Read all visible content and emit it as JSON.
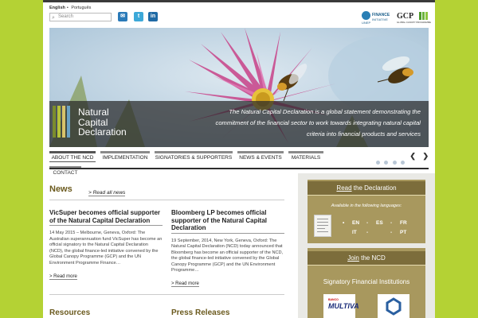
{
  "header": {
    "languages": [
      "English",
      "Português"
    ],
    "language_separator": "•",
    "search_placeholder": "Search",
    "social": [
      {
        "icon": "email-icon",
        "label": "✉",
        "color": "#2a7ab8"
      },
      {
        "icon": "twitter-icon",
        "label": "t",
        "color": "#3ca8d8"
      },
      {
        "icon": "linkedin-icon",
        "label": "in",
        "color": "#1f6aa5"
      }
    ],
    "unep_text1": "FINANCE",
    "unep_text2": "INITIATIVE",
    "unep_prefix": "UNEP",
    "gcp_text": "GCP",
    "gcp_subtext": "GLOBAL CANOPY PROGRAMME"
  },
  "hero": {
    "logo_lines": [
      "Natural",
      "Capital",
      "Declaration"
    ],
    "tagline": "The Natural Capital Declaration is a global statement demonstrating the commitment of the financial sector to work towards integrating natural capital criteria into financial products and services",
    "logo_colors": [
      "#7b8c2d",
      "#b4c23a",
      "#d8c36a",
      "#6ba2c4"
    ]
  },
  "nav": {
    "items": [
      "ABOUT THE NCD",
      "IMPLEMENTATION",
      "SIGNATORIES & SUPPORTERS",
      "NEWS & EVENTS",
      "MATERIALS"
    ],
    "contact": "CONTACT",
    "prev": "❮",
    "next": "❯"
  },
  "news": {
    "title": "News",
    "read_all": "> Read all news",
    "articles": [
      {
        "title": "VicSuper becomes official supporter of the Natural Capital Declaration",
        "body": "14 May 2015 – Melbourne, Geneva, Oxford: The Australian superannuation fund VicSuper has become an official signatory to the Natural Capital Declaration (NCD), the global finance-led initiative convened by the Global Canopy Programme (GCP) and the UN Environment Programme Finance…",
        "more": "> Read more"
      },
      {
        "title": "Bloomberg LP becomes official supporter of the Natural Capital Declaration",
        "body": "19 September, 2014, New York, Geneva, Oxford: The Natural Capital Declaration (NCD) today announced that Bloomberg has become an official supporter of the NCD, the global finance-led initiative convened by the Global Canopy Programme (GCP) and the UN Environment Programme…",
        "more": "> Read more"
      }
    ]
  },
  "sections": {
    "resources": "Resources",
    "press": "Press Releases"
  },
  "sidebar": {
    "read_title_prefix": "Read",
    "read_title_suffix": " the Declaration",
    "available": "Available in the following languages:",
    "languages": [
      "EN",
      "ES",
      "FR",
      "IT",
      "PT"
    ],
    "language_dash": "-",
    "join_title_prefix": "Join",
    "join_title_suffix": " the NCD",
    "signatory_label": "Signatory Financial Institutions",
    "bank1_small": "BANCO",
    "bank1": "MULTIVA"
  },
  "colors": {
    "page_bg": "#b4d234",
    "accent_gold": "#a8985e",
    "heading_brown": "#6b5a1e"
  }
}
